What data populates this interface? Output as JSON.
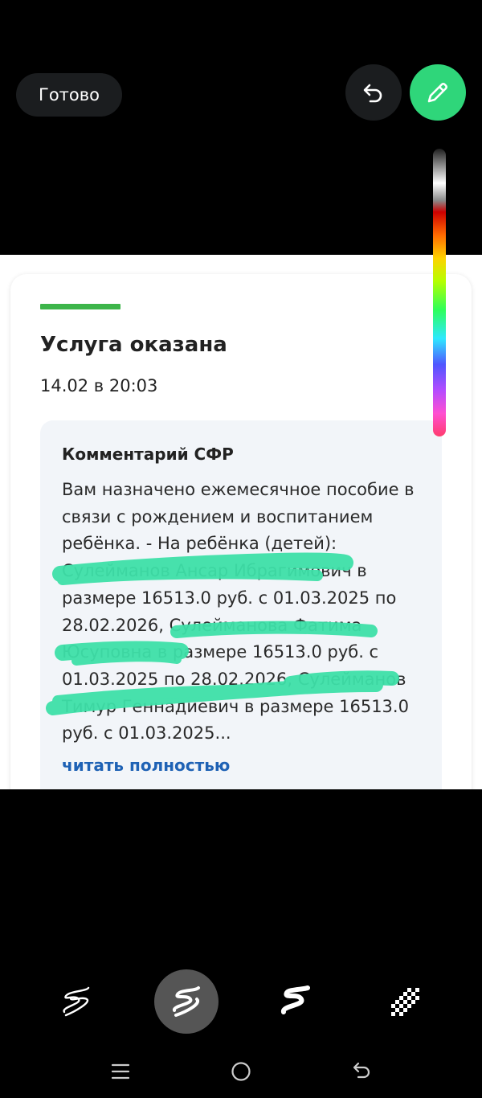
{
  "toolbar": {
    "done_label": "Готово",
    "undo_icon": "undo-icon",
    "pen_icon": "pencil-icon",
    "accent_color": "#2fd67a"
  },
  "card": {
    "status_title": "Услуга оказана",
    "status_date": "14.02 в 20:03",
    "accent_color": "#3db54a",
    "comment": {
      "title": "Комментарий СФР",
      "text": "Вам назначено ежемесячное пособие в связи с рождением и воспитанием ребёнка. - На ребёнка (детей): Сулейманов Ансар Ибрагимович в размере 16513.0 руб. с 01.03.2025 по 28.02.2026, Сулейманова Фатима Юсуповна в размере 16513.0 руб. с 01.03.2025 по 28.02.2026, Сулейманов Тимур Геннадиевич в размере 16513.0 руб. с 01.03.2025...",
      "read_more": "читать полностью"
    }
  },
  "brushes": [
    {
      "name": "thin-brush-icon",
      "selected": false
    },
    {
      "name": "marker-brush-icon",
      "selected": true
    },
    {
      "name": "thick-brush-icon",
      "selected": false
    },
    {
      "name": "pixelate-brush-icon",
      "selected": false
    }
  ],
  "navigation": [
    "recent-apps-icon",
    "home-icon",
    "back-icon"
  ]
}
